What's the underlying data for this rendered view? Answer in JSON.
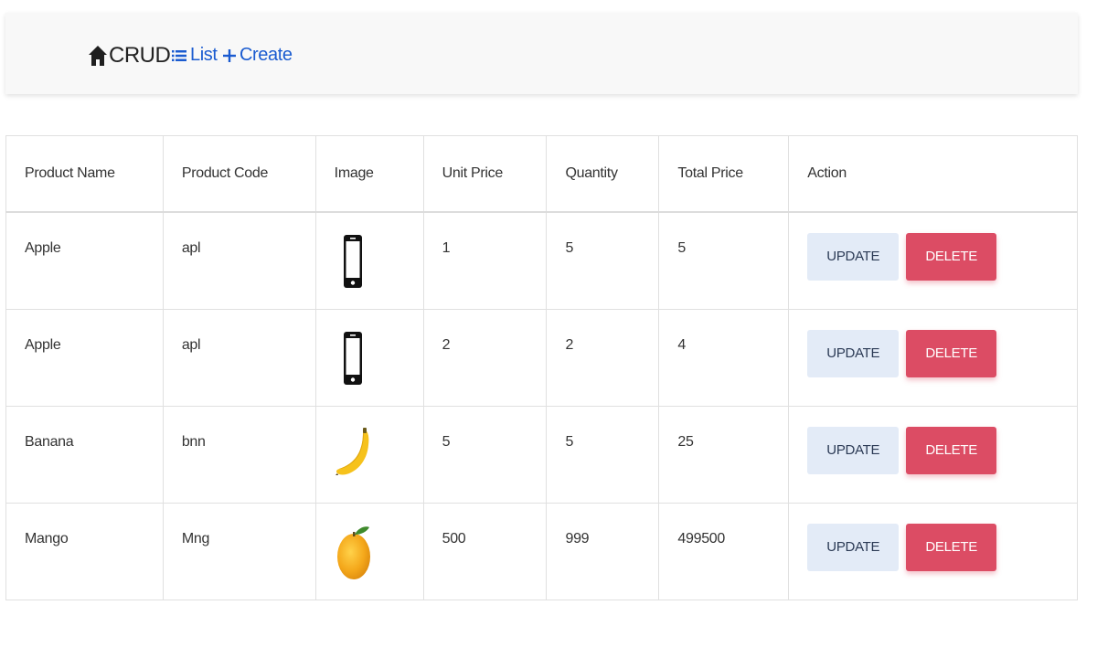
{
  "navbar": {
    "brand": "CRUD",
    "brand_icon": "home-icon",
    "links": [
      {
        "label": "List",
        "icon": "list-icon"
      },
      {
        "label": "Create",
        "icon": "plus-icon"
      }
    ],
    "link_color": "#1a5bd0"
  },
  "table": {
    "headers": [
      "Product Name",
      "Product Code",
      "Image",
      "Unit Price",
      "Quantity",
      "Total Price",
      "Action"
    ],
    "rows": [
      {
        "name": "Apple",
        "code": "apl",
        "image": "phone-icon",
        "unit_price": "1",
        "quantity": "5",
        "total_price": "5"
      },
      {
        "name": "Apple",
        "code": "apl",
        "image": "phone-icon",
        "unit_price": "2",
        "quantity": "2",
        "total_price": "4"
      },
      {
        "name": "Banana",
        "code": "bnn",
        "image": "banana-image",
        "unit_price": "5",
        "quantity": "5",
        "total_price": "25"
      },
      {
        "name": "Mango",
        "code": "Mng",
        "image": "mango-image",
        "unit_price": "500",
        "quantity": "999",
        "total_price": "499500"
      }
    ],
    "update_label": "UPDATE",
    "delete_label": "DELETE",
    "update_color": "#e3ebf7",
    "delete_color": "#dc4c64"
  }
}
